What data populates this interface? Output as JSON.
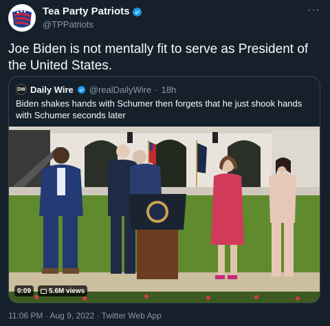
{
  "author": {
    "display_name": "Tea Party Patriots",
    "handle": "@TPPatriots",
    "avatar_icon": "tea-party-patriots-logo",
    "verified_icon": "verified-badge-icon"
  },
  "more_icon": "more-options-icon",
  "tweet": {
    "text": "Joe Biden is not mentally fit to serve as President of the United States."
  },
  "quote": {
    "avatar_label": "DW",
    "display_name": "Daily Wire",
    "handle": "@realDailyWire",
    "separator": "·",
    "time": "18h",
    "text": "Biden shakes hands with Schumer then forgets that he just shook hands with Schumer seconds later",
    "video": {
      "duration": "0:09",
      "views": "5.6M views",
      "views_icon": "chart-icon"
    }
  },
  "meta": {
    "timestamp": "11:06 PM · Aug 9, 2022 · Twitter Web App"
  },
  "colors": {
    "background": "#15202b",
    "text": "#f7f9f9",
    "muted": "#8b98a5",
    "verified": "#1d9bf0",
    "border": "#38444d"
  }
}
